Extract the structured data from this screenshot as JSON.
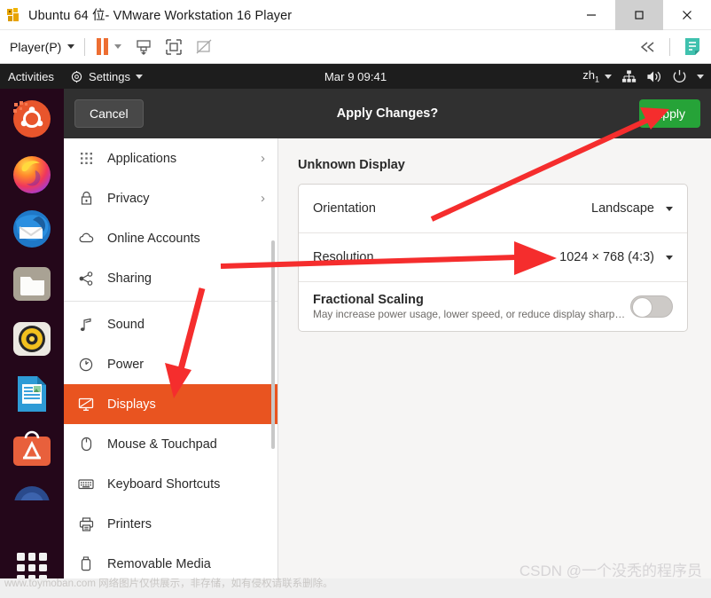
{
  "vmware": {
    "title": "Ubuntu 64 位- VMware Workstation 16 Player",
    "app_icon": "vmware-logo-icon",
    "window_controls": {
      "minimize": "minimize-icon",
      "maximize": "maximize-icon",
      "close": "close-icon"
    },
    "toolbar": {
      "player_menu": "Player(P)",
      "player_menu_mnemonic": "P",
      "pause_button": "pause-icon",
      "pause_dropdown": "chevron-down-icon",
      "icons": [
        "send-ctrl-alt-del-icon",
        "unity-mode-icon",
        "full-screen-icon"
      ],
      "collapse": "collapse-left-icon",
      "notes": "notes-icon"
    }
  },
  "gnome_topbar": {
    "activities": "Activities",
    "app_menu": "Settings",
    "app_menu_icon": "settings-gear-icon",
    "app_menu_caret": "chevron-down-icon",
    "clock": "Mar 9  09:41",
    "keyboard_indicator": "zh",
    "keyboard_sub": "1",
    "icons": [
      "network-wired-icon",
      "volume-icon",
      "power-icon"
    ],
    "system_caret": "chevron-down-icon"
  },
  "dock": {
    "items": [
      {
        "name": "ubuntu-help-icon",
        "label": "Ubuntu Help"
      },
      {
        "name": "firefox-icon",
        "label": "Firefox Web Browser"
      },
      {
        "name": "thunderbird-icon",
        "label": "Thunderbird Mail"
      },
      {
        "name": "files-icon",
        "label": "Files"
      },
      {
        "name": "rhythmbox-icon",
        "label": "Rhythmbox"
      },
      {
        "name": "libreoffice-writer-icon",
        "label": "LibreOffice Writer"
      },
      {
        "name": "ubuntu-software-icon",
        "label": "Ubuntu Software"
      },
      {
        "name": "help-disc-icon",
        "label": "Help"
      }
    ],
    "show_apps": "Show Applications"
  },
  "settings": {
    "header": {
      "cancel_label": "Cancel",
      "title": "Apply Changes?",
      "apply_label": "Apply"
    },
    "sidebar": {
      "items": [
        {
          "label": "Applications",
          "icon": "grid-dots-icon",
          "chevron": "›",
          "active": false
        },
        {
          "label": "Privacy",
          "icon": "lock-icon",
          "chevron": "›",
          "active": false
        },
        {
          "label": "Online Accounts",
          "icon": "cloud-icon",
          "chevron": "",
          "active": false
        },
        {
          "label": "Sharing",
          "icon": "share-nodes-icon",
          "chevron": "",
          "active": false
        },
        {
          "label": "Sound",
          "icon": "music-note-icon",
          "chevron": "",
          "active": false
        },
        {
          "label": "Power",
          "icon": "power-circle-icon",
          "chevron": "",
          "active": false
        },
        {
          "label": "Displays",
          "icon": "display-icon",
          "chevron": "",
          "active": true
        },
        {
          "label": "Mouse & Touchpad",
          "icon": "mouse-icon",
          "chevron": "",
          "active": false
        },
        {
          "label": "Keyboard Shortcuts",
          "icon": "keyboard-icon",
          "chevron": "",
          "active": false
        },
        {
          "label": "Printers",
          "icon": "printer-icon",
          "chevron": "",
          "active": false
        },
        {
          "label": "Removable Media",
          "icon": "usb-drive-icon",
          "chevron": "",
          "active": false
        }
      ],
      "divider_after_index": 3
    },
    "display_panel": {
      "section_title": "Unknown Display",
      "rows": {
        "orientation": {
          "label": "Orientation",
          "value": "Landscape",
          "caret": "chevron-down-icon"
        },
        "resolution": {
          "label": "Resolution",
          "value": "1024 × 768 (4:3)",
          "caret": "chevron-down-icon"
        },
        "fractional_scaling": {
          "label": "Fractional Scaling",
          "description": "May increase power usage, lower speed, or reduce display sharp…",
          "toggle_state": "off"
        }
      }
    }
  },
  "annotations": {
    "arrow_to_apply": "red-arrow-pointing-to-apply-button",
    "arrow_to_resolution": "red-arrow-pointing-to-resolution-value",
    "arrow_to_displays": "red-arrow-pointing-to-displays-sidebar-item"
  },
  "watermarks": {
    "left": "www.toymoban.com 网络图片仅供展示，非存储，如有侵权请联系删除。",
    "right": "CSDN @一个没秃的程序员"
  },
  "colors": {
    "ubuntu_orange": "#e95420",
    "apply_green": "#26a338",
    "header_dark": "#303030",
    "topbar_dark": "#1d1d1d",
    "dock_purple": "#2c001e",
    "annotation_red": "#f52d2d",
    "content_bg": "#f6f5f4"
  }
}
